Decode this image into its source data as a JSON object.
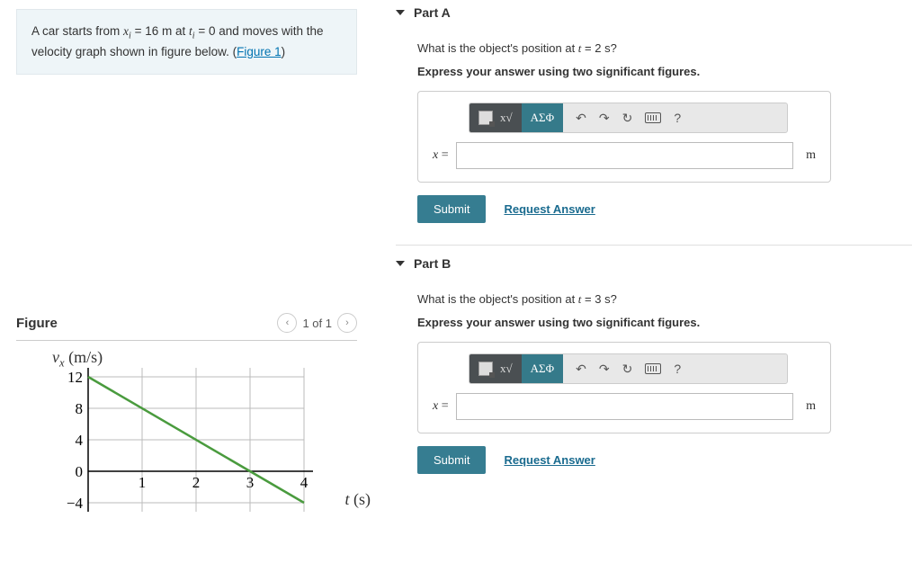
{
  "problem": {
    "text_prefix": "A car starts from ",
    "xi_var": "x",
    "xi_sub": "i",
    "xi_val": " = 16 m",
    "text_at": " at ",
    "ti_var": "t",
    "ti_sub": "i",
    "ti_val": " = 0",
    "text_suffix": " and moves with the velocity graph shown in figure below. (",
    "figure_link": "Figure 1",
    "text_close": ")"
  },
  "figure": {
    "title": "Figure",
    "page": "1 of 1",
    "y_axis_label_var": "v",
    "y_axis_label_sub": "x",
    "y_axis_label_unit": " (m/s)",
    "x_axis_label_var": "t",
    "x_axis_label_unit": " (s)"
  },
  "chart_data": {
    "type": "line",
    "x": [
      0,
      1,
      2,
      3,
      4
    ],
    "y": [
      12,
      8,
      4,
      0,
      -4
    ],
    "xlabel": "t (s)",
    "ylabel": "v_x (m/s)",
    "xlim": [
      0,
      4.2
    ],
    "ylim": [
      -5,
      13
    ],
    "x_ticks": [
      1,
      2,
      3,
      4
    ],
    "y_ticks": [
      -4,
      0,
      4,
      8,
      12
    ],
    "line_color": "#4a9b3e"
  },
  "parts": {
    "a": {
      "label": "Part A",
      "question_prefix": "What is the object's position at ",
      "question_var": "t",
      "question_val": " = 2 s",
      "question_suffix": "?",
      "sig": "Express your answer using two significant figures.",
      "greek": "ΑΣΦ",
      "help": "?",
      "lhs_var": "x",
      "lhs_eq": " = ",
      "unit": "m",
      "submit": "Submit",
      "request": "Request Answer"
    },
    "b": {
      "label": "Part B",
      "question_prefix": "What is the object's position at ",
      "question_var": "t",
      "question_val": " = 3 s",
      "question_suffix": "?",
      "sig": "Express your answer using two significant figures.",
      "greek": "ΑΣΦ",
      "help": "?",
      "lhs_var": "x",
      "lhs_eq": " = ",
      "unit": "m",
      "submit": "Submit",
      "request": "Request Answer"
    }
  }
}
